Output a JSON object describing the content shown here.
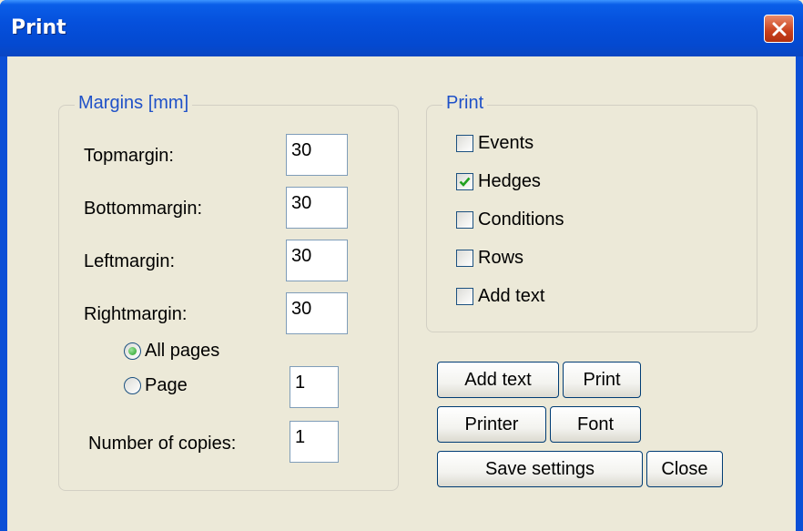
{
  "window": {
    "title": "Print",
    "close_icon": "close-x-icon"
  },
  "margins": {
    "legend": "Margins [mm]",
    "top_label": "Topmargin:",
    "top_value": "30",
    "bottom_label": "Bottommargin:",
    "bottom_value": "30",
    "left_label": "Leftmargin:",
    "left_value": "30",
    "right_label": "Rightmargin:",
    "right_value": "30",
    "all_pages_label": "All pages",
    "page_label": "Page",
    "page_value": "1",
    "copies_label": "Number of copies:",
    "copies_value": "1",
    "range_selected": "All pages"
  },
  "print_options": {
    "legend": "Print",
    "items": [
      {
        "label": "Events",
        "checked": false
      },
      {
        "label": "Hedges",
        "checked": true
      },
      {
        "label": "Conditions",
        "checked": false
      },
      {
        "label": "Rows",
        "checked": false
      },
      {
        "label": "Add text",
        "checked": false
      }
    ]
  },
  "buttons": {
    "add_text": "Add text",
    "print": "Print",
    "printer": "Printer",
    "font": "Font",
    "save_settings": "Save settings",
    "close": "Close"
  },
  "colors": {
    "titlebar": "#0550dc",
    "dialog_bg": "#ece9d8",
    "legend_text": "#1f51c8",
    "close_button": "#c9401c",
    "check_mark": "#21a121"
  }
}
